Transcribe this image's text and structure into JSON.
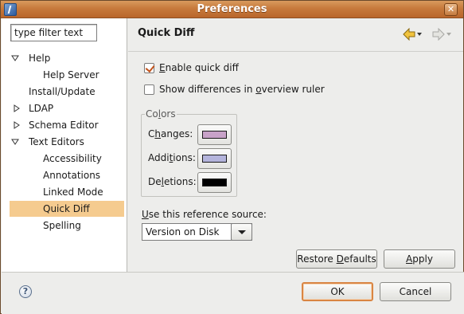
{
  "window": {
    "title": "Preferences",
    "close_glyph": "✕"
  },
  "filter": {
    "value": "type filter text"
  },
  "tree": {
    "items": [
      {
        "label": "Help"
      },
      {
        "label": "Help Server"
      },
      {
        "label": "Install/Update"
      },
      {
        "label": "LDAP"
      },
      {
        "label": "Schema Editor"
      },
      {
        "label": "Text Editors"
      },
      {
        "label": "Accessibility"
      },
      {
        "label": "Annotations"
      },
      {
        "label": "Linked Mode"
      },
      {
        "label": "Quick Diff"
      },
      {
        "label": "Spelling"
      }
    ]
  },
  "page": {
    "title": "Quick Diff",
    "enable": {
      "checked": true,
      "pre": "",
      "mn": "E",
      "post": "nable quick diff"
    },
    "overview": {
      "checked": false,
      "pre": "Show differences in ",
      "mn": "o",
      "post": "verview ruler"
    },
    "colors": {
      "legend_pre": "Co",
      "legend_mn": "l",
      "legend_post": "ors",
      "changes": {
        "pre": "C",
        "mn": "h",
        "post": "anges:",
        "color": "#c8a2c8"
      },
      "additions": {
        "pre": "Addi",
        "mn": "t",
        "post": "ions:",
        "color": "#b4b4dc"
      },
      "deletions": {
        "pre": "De",
        "mn": "l",
        "post": "etions:",
        "color": "#000000"
      }
    },
    "reference": {
      "label_pre": "",
      "label_mn": "U",
      "label_post": "se this reference source:",
      "value": "Version on Disk"
    },
    "buttons": {
      "restore_pre": "Restore ",
      "restore_mn": "D",
      "restore_post": "efaults",
      "apply_pre": "",
      "apply_mn": "A",
      "apply_post": "pply"
    }
  },
  "footer": {
    "help_glyph": "?",
    "ok": "OK",
    "cancel": "Cancel"
  },
  "colors": {
    "titlebar": "#c77a3c",
    "selection": "#f5cb8f",
    "default_button_border": "#d98543",
    "back_arrow": "#e8b83a"
  }
}
